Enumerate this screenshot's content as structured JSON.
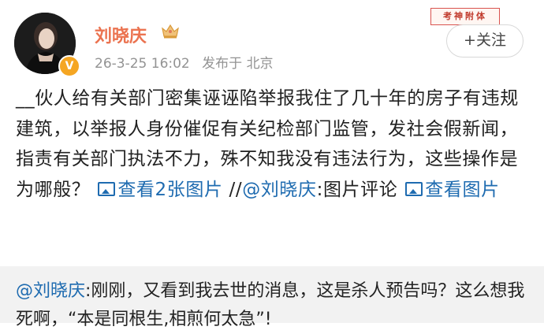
{
  "user": {
    "name": "刘晓庆",
    "timestamp": "26-3-25 16:02",
    "location_prefix": "发布于",
    "location": "北京"
  },
  "stamp_text": "考神附体",
  "follow_label": "+关注",
  "post": {
    "text": "__伙人给有关部门密集诬诬陷举报我住了几十年的房子有违规建筑，以举报人身份催促有关纪检部门监管，发社会假新闻，指责有关部门执法不力，殊不知我没有违法行为，这些操作是为哪般？",
    "view_images_label": "查看2张图片",
    "repost_prefix": "//",
    "repost_mention": "@刘晓庆",
    "repost_suffix": ":图片评论",
    "view_image_label": "查看图片"
  },
  "quoted": {
    "mention": "@刘晓庆",
    "text": ":刚刚，又看到我去世的消息，这是杀人预告吗？这么想我死啊，“本是同根生,相煎何太急”!"
  },
  "colors": {
    "username": "#eb7350",
    "link": "#1e6bb0",
    "meta": "#939393",
    "quoted_bg": "#f2f2f2"
  }
}
